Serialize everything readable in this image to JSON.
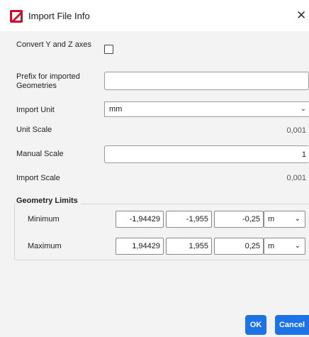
{
  "window": {
    "title": "Import File Info",
    "close_glyph": "✕"
  },
  "form": {
    "convert_yz_label": "Convert Y and Z axes",
    "convert_yz_checked": false,
    "prefix_label": "Prefix for imported Geometries",
    "prefix_value": "",
    "import_unit_label": "Import Unit",
    "import_unit_value": "mm",
    "unit_scale_label": "Unit Scale",
    "unit_scale_value": "0,001",
    "manual_scale_label": "Manual Scale",
    "manual_scale_value": "1",
    "import_scale_label": "Import Scale",
    "import_scale_value": "0,001"
  },
  "geometry_limits": {
    "title": "Geometry Limits",
    "minimum": {
      "label": "Minimum",
      "x": "-1,94429",
      "y": "-1,955",
      "z": "-0,25",
      "unit": "m"
    },
    "maximum": {
      "label": "Maximum",
      "x": "1,94429",
      "y": "1,955",
      "z": "0,25",
      "unit": "m"
    }
  },
  "buttons": {
    "ok": "OK",
    "cancel": "Cancel"
  },
  "colors": {
    "accent": "#1c73e8",
    "app_icon": "#c8102e"
  }
}
